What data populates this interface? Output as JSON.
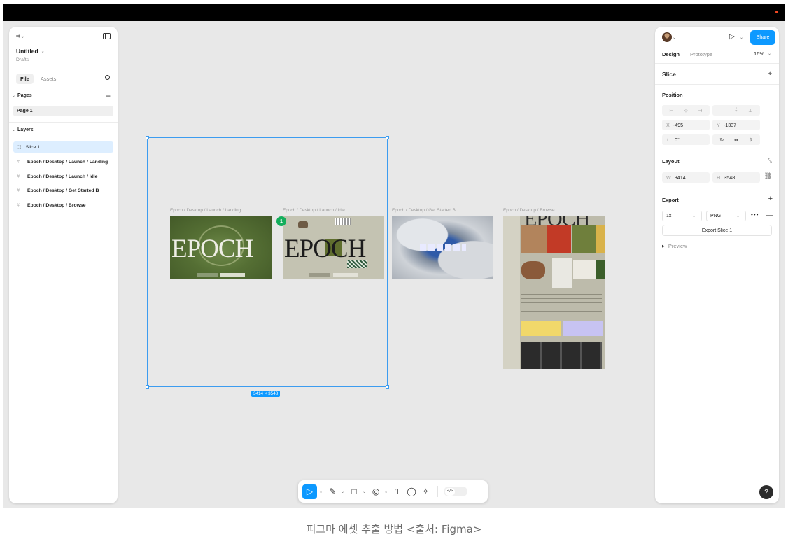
{
  "left_panel": {
    "file_title": "Untitled",
    "file_location": "Drafts",
    "tab_file": "File",
    "tab_assets": "Assets",
    "pages_heading": "Pages",
    "pages": [
      "Page 1"
    ],
    "layers_heading": "Layers",
    "layers": [
      "Slice 1",
      "Epoch / Desktop / Launch / Landing",
      "Epoch / Desktop / Launch / Idle",
      "Epoch / Desktop / Get Started B",
      "Epoch / Desktop / Browse"
    ]
  },
  "right_panel": {
    "share_label": "Share",
    "tab_design": "Design",
    "tab_prototype": "Prototype",
    "zoom": "16%",
    "selection_title": "Slice",
    "position_heading": "Position",
    "x_label": "X",
    "x_value": "-495",
    "y_label": "Y",
    "y_value": "-1337",
    "rotation": "0°",
    "layout_heading": "Layout",
    "w_label": "W",
    "w_value": "3414",
    "h_label": "H",
    "h_value": "3548",
    "export_heading": "Export",
    "export_scale": "1x",
    "export_format": "PNG",
    "export_button": "Export Slice 1",
    "preview_label": "Preview"
  },
  "canvas": {
    "frames": [
      "Epoch / Desktop / Launch / Landing",
      "Epoch / Desktop / Launch / Idle",
      "Epoch / Desktop / Get Started B",
      "Epoch / Desktop / Browse"
    ],
    "epoch_text": "EPOCH",
    "selection_size": "3414 × 3548",
    "comment_count": "1"
  },
  "caption": "피그마 에셋 추출 방법 <출처: Figma>",
  "colors": {
    "accent": "#0d99ff",
    "canvas_bg": "#e8e8e8",
    "selection": "#3c9cf0",
    "comment": "#14ae5c"
  }
}
